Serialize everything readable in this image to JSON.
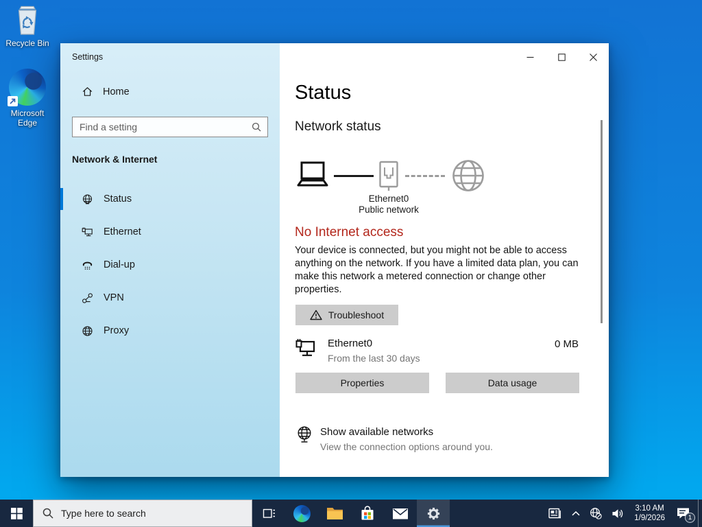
{
  "desktop": {
    "icons": [
      {
        "label": "Recycle Bin"
      },
      {
        "label": "Microsoft Edge"
      }
    ]
  },
  "window": {
    "title": "Settings",
    "sidebar": {
      "home_label": "Home",
      "search_placeholder": "Find a setting",
      "section_title": "Network & Internet",
      "selected_item": "Status",
      "items": [
        {
          "label": "Status"
        },
        {
          "label": "Ethernet"
        },
        {
          "label": "Dial-up"
        },
        {
          "label": "VPN"
        },
        {
          "label": "Proxy"
        }
      ]
    },
    "main": {
      "page_title": "Status",
      "section_heading": "Network status",
      "diagram": {
        "adapter": "Ethernet0",
        "network_type": "Public network"
      },
      "alert": {
        "title": "No Internet access",
        "body": "Your device is connected, but you might not be able to access anything on the network. If you have a limited data plan, you can make this network a metered connection or change other properties."
      },
      "troubleshoot_label": "Troubleshoot",
      "usage": {
        "adapter": "Ethernet0",
        "period": "From the last 30 days",
        "amount": "0 MB"
      },
      "properties_label": "Properties",
      "data_usage_label": "Data usage",
      "available_networks": {
        "title": "Show available networks",
        "subtitle": "View the connection options around you."
      }
    }
  },
  "taskbar": {
    "search_placeholder": "Type here to search",
    "clock": {
      "time": "3:10 AM",
      "date": "1/9/2026"
    },
    "notification_badge": "1"
  },
  "colors": {
    "accent": "#0078d7",
    "alert_red": "#b3271c",
    "desktop_top": "#1273d4",
    "desktop_bottom": "#02aaf0",
    "taskbar": "#182840",
    "sidebar_tint": "#c5e5f3",
    "button_gray": "#cccccc"
  }
}
